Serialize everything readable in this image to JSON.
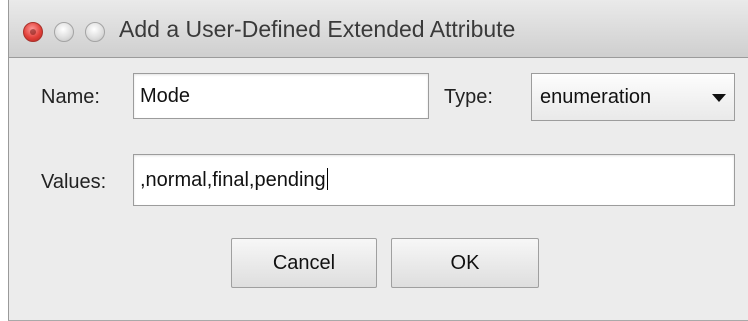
{
  "window": {
    "title": "Add a User-Defined Extended Attribute"
  },
  "form": {
    "name_label": "Name:",
    "name_value": "Mode",
    "type_label": "Type:",
    "type_selected": "enumeration",
    "values_label": "Values:",
    "values_value": ",normal,final,pending"
  },
  "buttons": {
    "cancel": "Cancel",
    "ok": "OK"
  },
  "colors": {
    "close_light": "#e2413a",
    "window_bg": "#ececec"
  },
  "icons": [
    "close-light-icon",
    "minimize-light-icon",
    "zoom-light-icon",
    "dropdown-arrow-icon"
  ]
}
